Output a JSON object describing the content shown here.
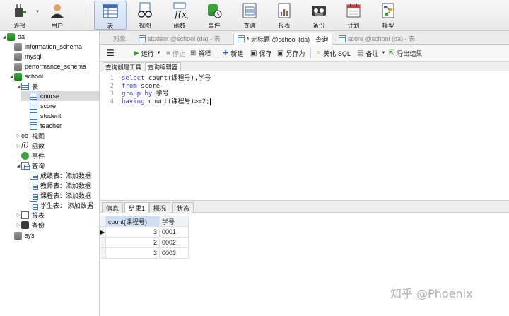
{
  "toolbar": {
    "connect": "连接",
    "user": "用户",
    "table": "表",
    "view": "视图",
    "function": "函数",
    "event": "事件",
    "query": "查询",
    "report": "报表",
    "backup": "备份",
    "schedule": "计划",
    "model": "模型"
  },
  "sidebar": {
    "connection": "da",
    "databases": [
      "information_schema",
      "mysql",
      "performance_schema",
      "school",
      "sys"
    ],
    "tables_group": "表",
    "tables": [
      "course",
      "score",
      "student",
      "teacher"
    ],
    "views_group": "视图",
    "functions_group": "函数",
    "events_group": "事件",
    "queries_group": "查询",
    "queries": [
      "成绩表：添加数据",
      "教师表：添加数据",
      "课程表：添加数据",
      "学生表： 添加数据"
    ],
    "reports_group": "报表",
    "backups_group": "备份"
  },
  "tabs": {
    "objects": "对象",
    "student_tab": "student @school (da) - 表",
    "untitled_tab": "* 无标题 @school (da) - 查询",
    "score_tab": "score @school (da) - 表"
  },
  "query_toolbar": {
    "run": "运行",
    "stop": "停止",
    "explain": "解释",
    "new": "新建",
    "save": "保存",
    "save_as": "另存为",
    "beautify": "美化 SQL",
    "comment": "备注",
    "export": "导出结果"
  },
  "subtabs": {
    "builder": "查询创建工具",
    "editor": "查询编辑器"
  },
  "editor": {
    "lines": [
      {
        "n": "1",
        "kw": "select",
        "rest": " count(课程号),学号"
      },
      {
        "n": "2",
        "kw": "from",
        "rest": " score"
      },
      {
        "n": "3",
        "kw": "group by",
        "rest": " 学号"
      },
      {
        "n": "4",
        "kw": "having",
        "rest": " count(课程号)>=2;"
      }
    ]
  },
  "result_tabs": {
    "info": "信息",
    "result1": "结果1",
    "profile": "概况",
    "status": "状态"
  },
  "results": {
    "columns": [
      "count(课程号)",
      "学号"
    ],
    "rows": [
      [
        "3",
        "0001"
      ],
      [
        "2",
        "0002"
      ],
      [
        "3",
        "0003"
      ]
    ]
  },
  "watermark": "知乎 @Phoenix"
}
